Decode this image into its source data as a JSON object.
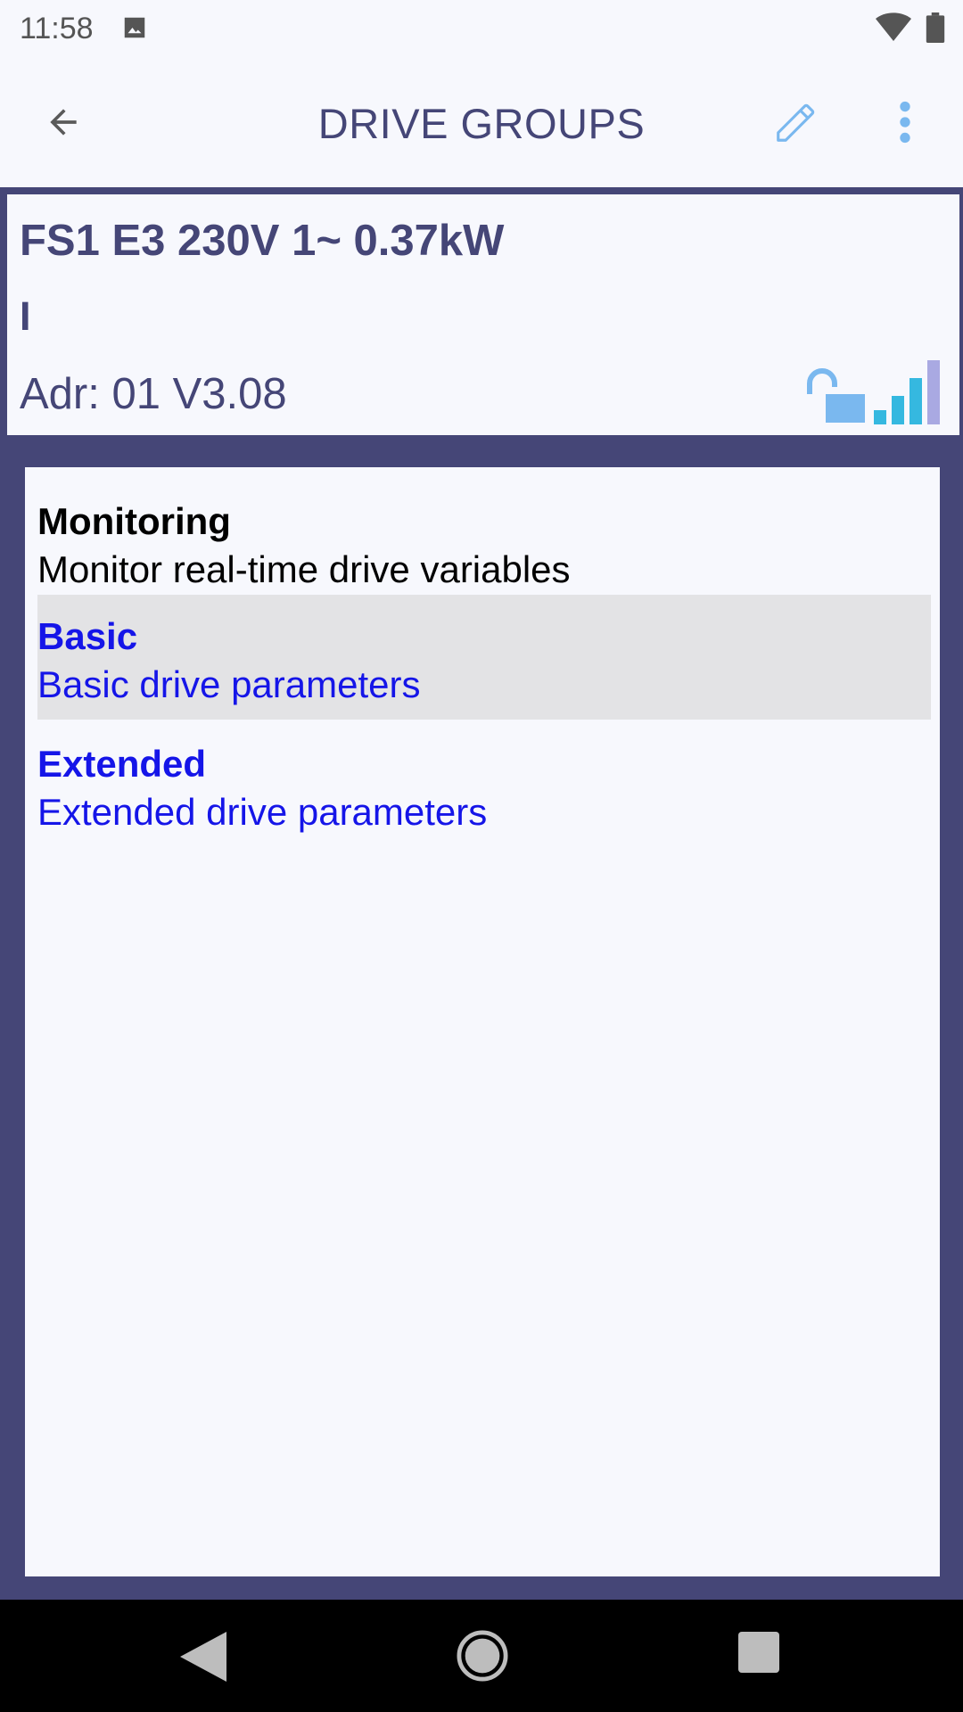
{
  "status_bar": {
    "time": "11:58",
    "icons": [
      "photo-icon",
      "wifi-icon",
      "battery-icon"
    ]
  },
  "app_bar": {
    "title": "DRIVE GROUPS",
    "icons": [
      "back-arrow-icon",
      "pencil-icon",
      "more-vert-icon"
    ],
    "accent": "#454677",
    "icon_blue": "#7ab8ef"
  },
  "device": {
    "name": "FS1 E3 230V 1~ 0.37kW",
    "state": "I",
    "address": "Adr: 01 V3.08",
    "icons": [
      "unlocked-padlock-icon",
      "signal-strength-icon"
    ]
  },
  "groups": {
    "items": [
      {
        "title": "Monitoring",
        "description": "Monitor real-time drive variables",
        "style": "dark",
        "selected": false
      },
      {
        "title": "Basic",
        "description": "Basic drive parameters",
        "style": "blue",
        "selected": true
      },
      {
        "title": "Extended",
        "description": "Extended drive parameters",
        "style": "blue",
        "selected": false
      }
    ],
    "link_color": "#1515e8",
    "selected_bg": "#e3e3e5"
  },
  "nav_bar": {
    "icons": [
      "nav-back-icon",
      "nav-home-icon",
      "nav-recents-icon"
    ]
  }
}
